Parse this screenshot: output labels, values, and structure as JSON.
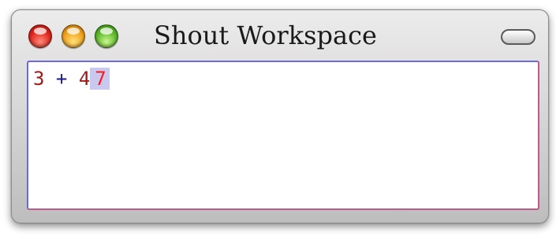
{
  "window": {
    "title": "Shout Workspace"
  },
  "editor": {
    "tokens": {
      "operand1": "3",
      "operator": "+",
      "operand2": "4",
      "result": "7"
    }
  },
  "colors": {
    "number": "#a01818",
    "operator": "#1a1a8a",
    "result": "#ff1a1a",
    "result_highlight": "#c9c9f0"
  }
}
